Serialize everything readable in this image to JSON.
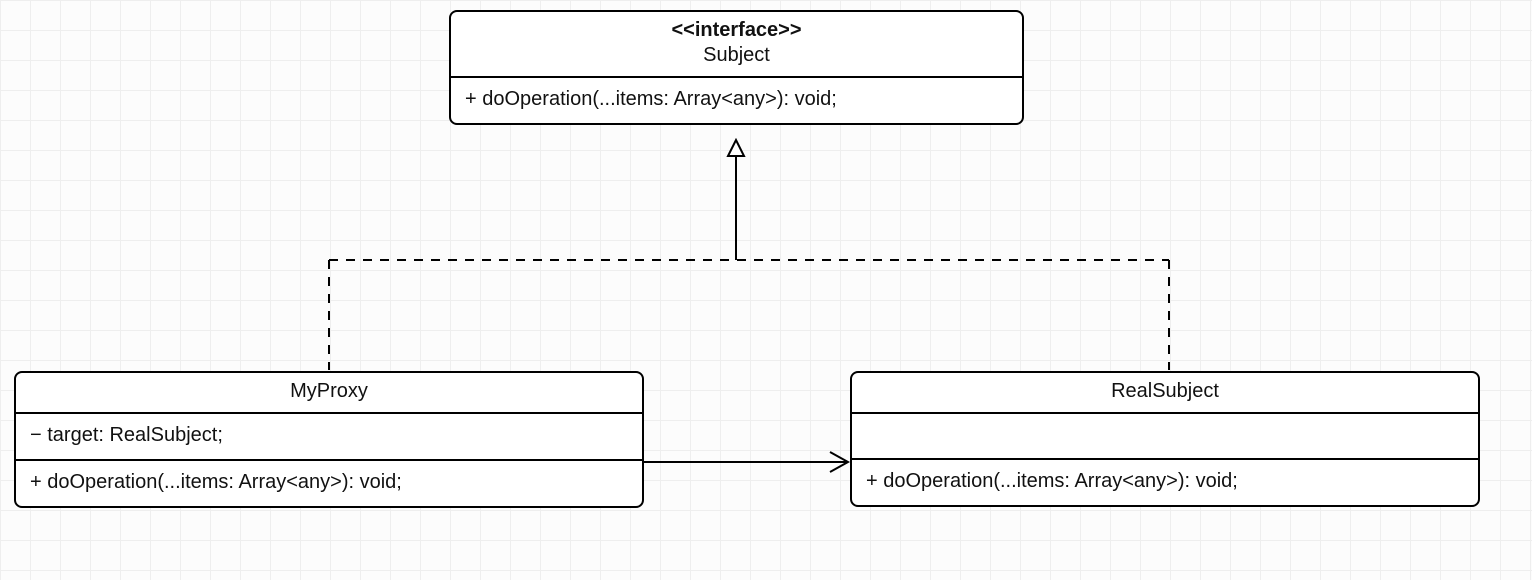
{
  "diagram": {
    "subject": {
      "stereotype": "<<interface>>",
      "name": "Subject",
      "operation": "+ doOperation(...items: Array<any>): void;"
    },
    "myproxy": {
      "name": "MyProxy",
      "attribute": "− target: RealSubject;",
      "operation": "+ doOperation(...items: Array<any>): void;"
    },
    "realsubject": {
      "name": "RealSubject",
      "attribute_empty": "",
      "operation": "+ doOperation(...items: Array<any>): void;"
    },
    "relations": {
      "myproxy_implements_subject": "realization",
      "realsubject_implements_subject": "realization",
      "myproxy_uses_realsubject": "association"
    }
  }
}
